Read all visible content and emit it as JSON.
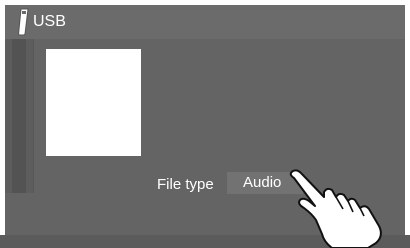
{
  "header": {
    "title": "USB",
    "icon": "usb-stick-icon"
  },
  "album_art": {
    "icon": "album-art-placeholder"
  },
  "file_type": {
    "label": "File type",
    "value": "Audio"
  },
  "annotation": {
    "icon": "pointing-hand-icon"
  },
  "colors": {
    "header_bg": "#6b6b6b",
    "content_bg": "#646464",
    "button_bg": "#727272",
    "text": "#ffffff"
  }
}
